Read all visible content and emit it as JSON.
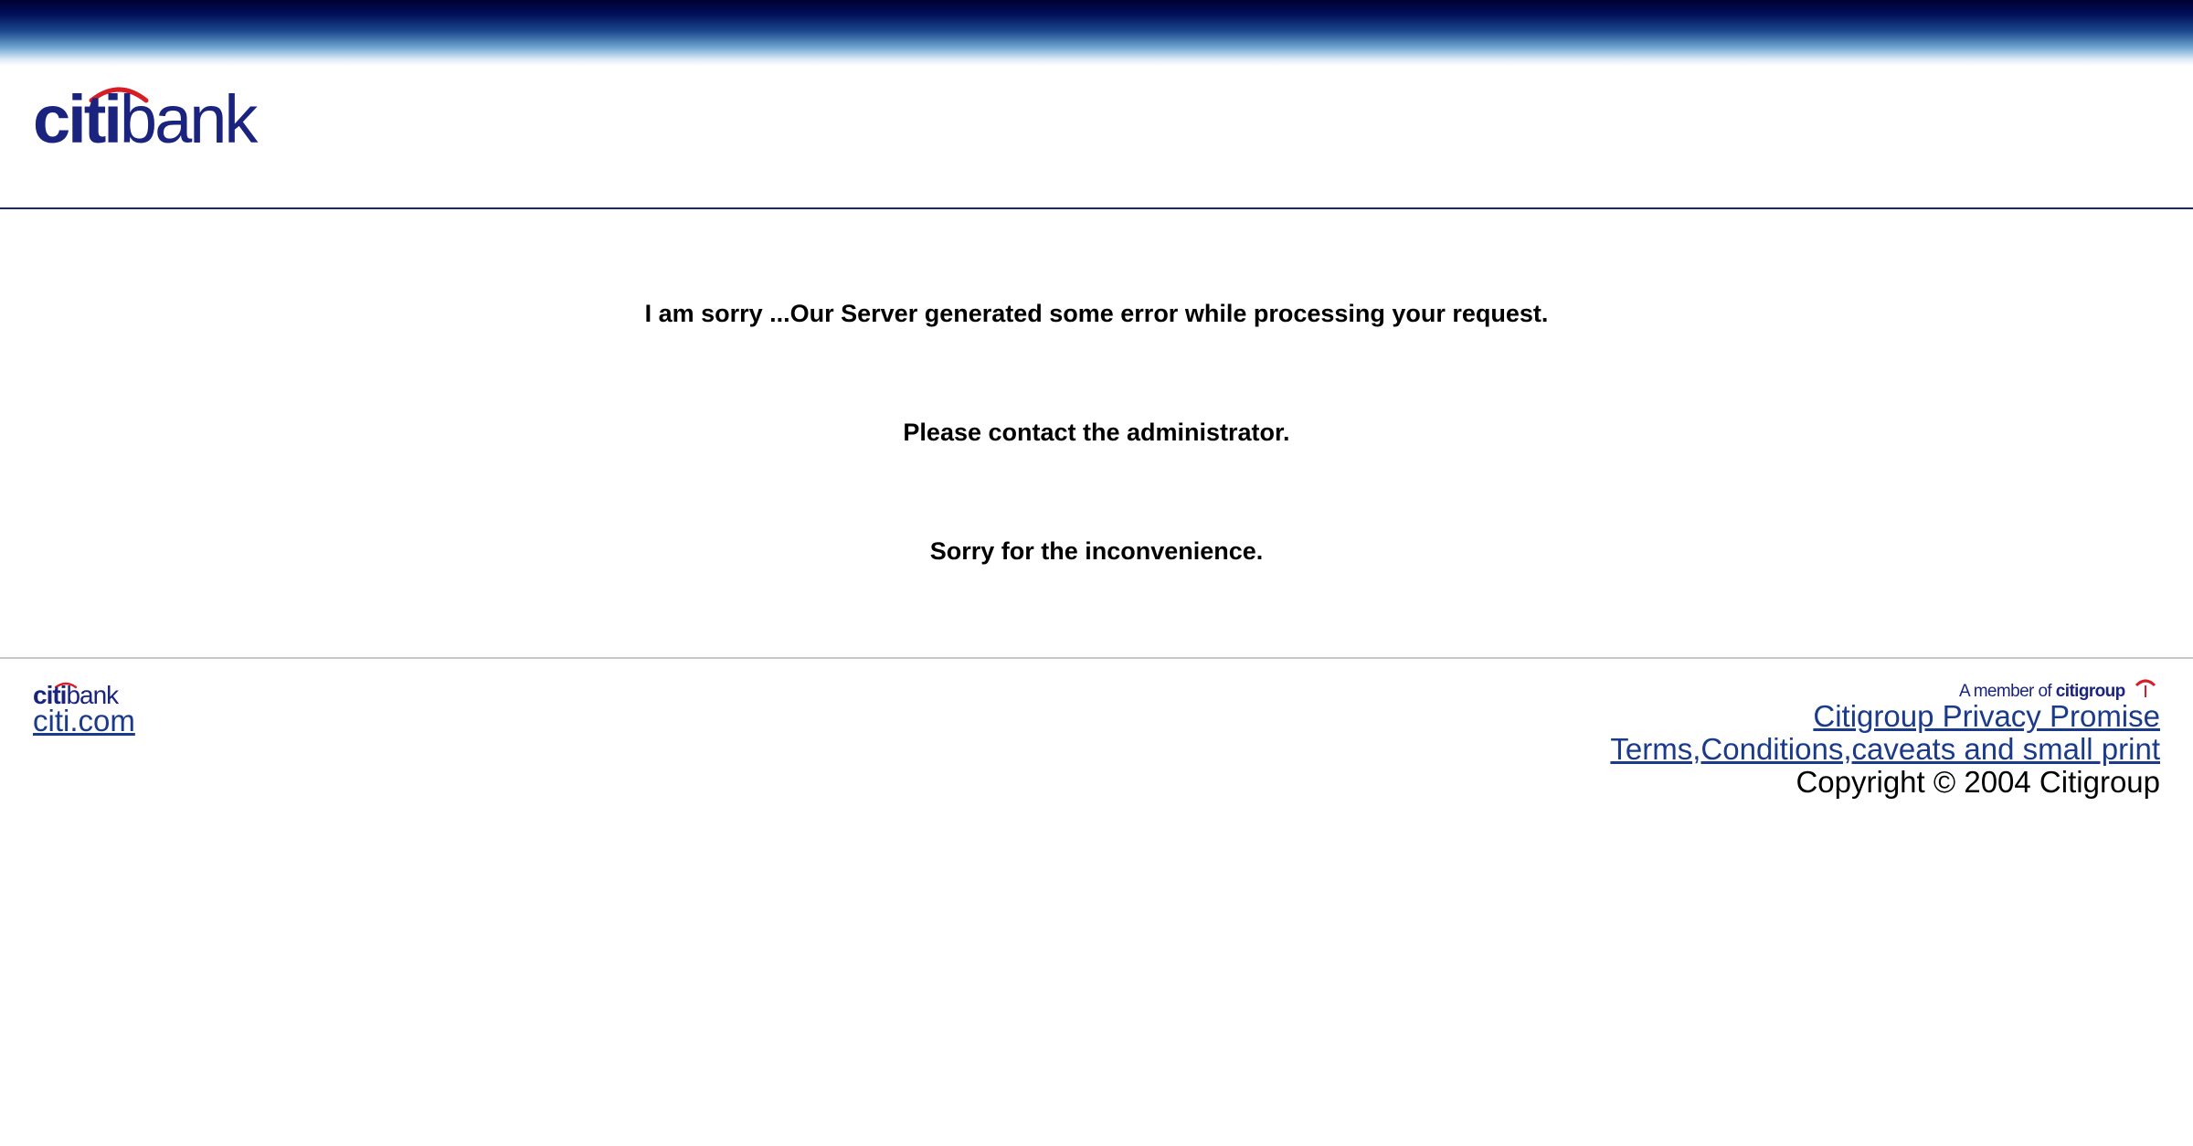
{
  "header": {
    "logo_text": "citibank"
  },
  "error": {
    "line1": "I am sorry ...Our Server generated some error while processing your request.",
    "line2": "Please contact the administrator.",
    "line3": "Sorry for the inconvenience."
  },
  "footer": {
    "logo_text": "citibank",
    "citi_link": "citi.com",
    "member_badge": "A member of citigroup",
    "privacy_link": "Citigroup Privacy Promise",
    "terms_link": "Terms,Conditions,caveats and small print",
    "copyright": "Copyright © 2004 Citigroup"
  },
  "colors": {
    "brand_navy": "#1a237e",
    "brand_red": "#d71e28",
    "link": "#1a3a8a",
    "header_rule": "#1a2a6c",
    "footer_rule": "#c8c8c8"
  }
}
